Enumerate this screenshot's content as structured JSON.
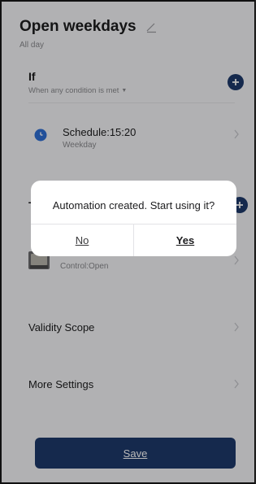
{
  "header": {
    "title": "Open weekdays",
    "subtitle": "All day"
  },
  "if_section": {
    "label": "If",
    "condition_mode": "When any condition is met",
    "condition": {
      "title": "Schedule:15:20",
      "subtitle": "Weekday"
    }
  },
  "then_section": {
    "label": "T",
    "action": {
      "subtitle": "Control:Open"
    }
  },
  "rows": {
    "validity_scope": "Validity Scope",
    "more_settings": "More Settings"
  },
  "save_label": "Save",
  "dialog": {
    "message": "Automation created. Start using it?",
    "no_label": "No",
    "yes_label": "Yes"
  },
  "icons": {
    "edit": "pencil-icon",
    "add": "plus-icon",
    "clock": "clock-icon",
    "chevron": "chevron-right-icon",
    "device": "curtain-device-icon"
  },
  "colors": {
    "accent": "#1e3a6b",
    "clock_accent": "#2f6fd6",
    "background": "#f5f6f8"
  }
}
